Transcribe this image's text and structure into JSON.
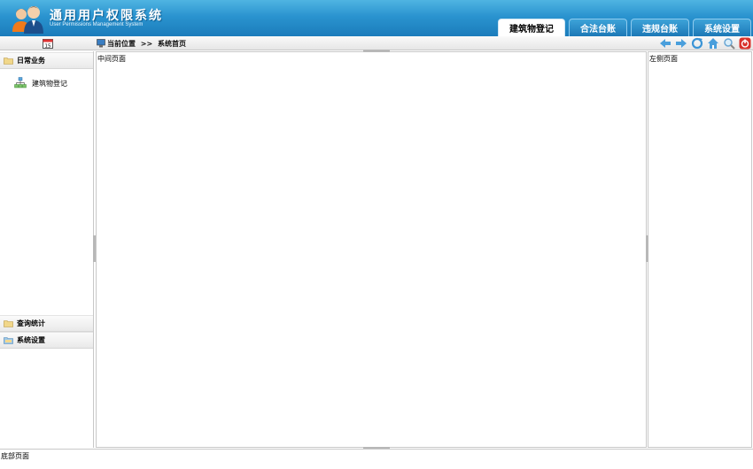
{
  "header": {
    "title": "通用用户权限系统",
    "subtitle": "User Permissions Management System",
    "tabs": [
      {
        "label": "建筑物登记",
        "active": true
      },
      {
        "label": "合法台账",
        "active": false
      },
      {
        "label": "违规台账",
        "active": false
      },
      {
        "label": "系统设置",
        "active": false
      }
    ]
  },
  "toolbar": {
    "calendar_day": "15",
    "breadcrumb_label": "当前位置",
    "breadcrumb_sep": ">>",
    "breadcrumb_page": "系统首页",
    "icons": [
      "back-icon",
      "forward-icon",
      "refresh-icon",
      "home-icon",
      "search-icon",
      "power-icon"
    ]
  },
  "sidebar": {
    "sections": [
      {
        "label": "日常业务",
        "items": [
          {
            "label": "建筑物登记"
          }
        ]
      },
      {
        "label": "查询统计",
        "items": []
      },
      {
        "label": "系统设置",
        "items": []
      }
    ]
  },
  "center": {
    "label": "中间页面"
  },
  "right": {
    "label": "左侧页面"
  },
  "footer": {
    "label": "底部页面"
  },
  "colors": {
    "header_blue": "#2a93cf",
    "tab_text": "#ffffff",
    "border": "#c8c8c8"
  }
}
